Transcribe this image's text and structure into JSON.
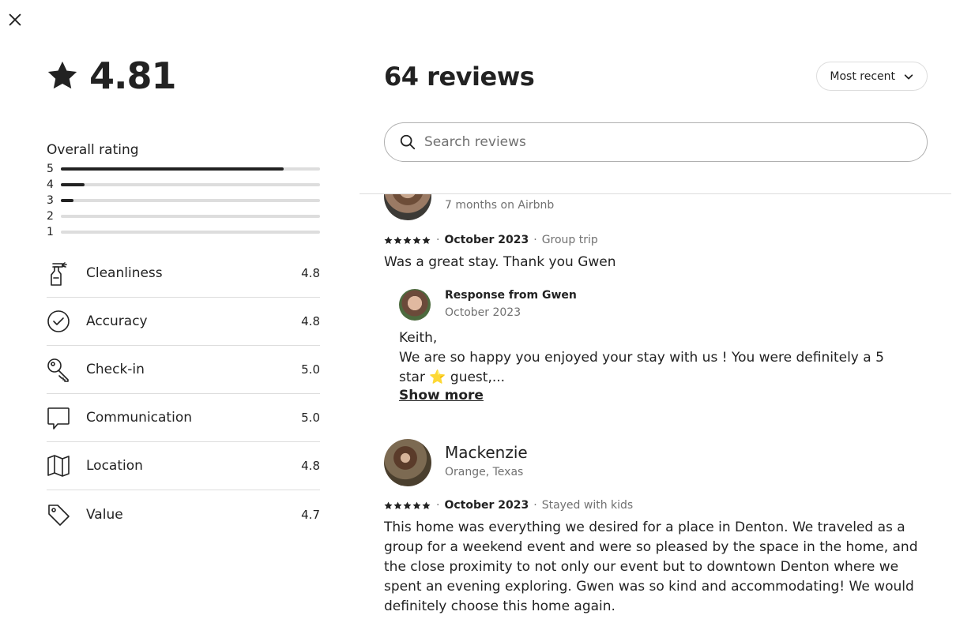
{
  "overall": {
    "score": "4.81",
    "rating_label": "Overall rating",
    "distribution": [
      {
        "stars": "5",
        "fraction": 0.86
      },
      {
        "stars": "4",
        "fraction": 0.09
      },
      {
        "stars": "3",
        "fraction": 0.05
      },
      {
        "stars": "2",
        "fraction": 0.0
      },
      {
        "stars": "1",
        "fraction": 0.0
      }
    ]
  },
  "categories": [
    {
      "label": "Cleanliness",
      "value": "4.8",
      "icon": "spray-bottle-icon"
    },
    {
      "label": "Accuracy",
      "value": "4.8",
      "icon": "check-circle-icon"
    },
    {
      "label": "Check-in",
      "value": "5.0",
      "icon": "key-icon"
    },
    {
      "label": "Communication",
      "value": "5.0",
      "icon": "chat-bubble-icon"
    },
    {
      "label": "Location",
      "value": "4.8",
      "icon": "map-icon"
    },
    {
      "label": "Value",
      "value": "4.7",
      "icon": "tag-icon"
    }
  ],
  "header": {
    "reviews_count": "64 reviews",
    "sort_label": "Most recent"
  },
  "search": {
    "placeholder": "Search reviews"
  },
  "reviews": [
    {
      "subtitle": "7 months on Airbnb",
      "date": "October 2023",
      "trip": "Group trip",
      "separator": "·",
      "text": "Was a great stay. Thank you Gwen",
      "response": {
        "from": "Response from Gwen",
        "date": "October 2023",
        "text_line1": "Keith,",
        "text_line2": "We are so happy you enjoyed your stay with us ! You were definitely a 5 star ⭐ guest,...",
        "show_more": "Show more"
      }
    },
    {
      "name": "Mackenzie",
      "location": "Orange, Texas",
      "date": "October 2023",
      "trip": "Stayed with kids",
      "separator": "·",
      "text": "This home was everything we desired for a place in Denton. We traveled as a group for a weekend event and were so pleased by the space in the home, and the close proximity to not only our event but to downtown Denton where we spent an evening exploring. Gwen was so kind and accommodating! We would definitely choose this home again."
    }
  ],
  "colors": {
    "text": "#222222",
    "muted": "#717171",
    "divider": "#dddddd"
  }
}
